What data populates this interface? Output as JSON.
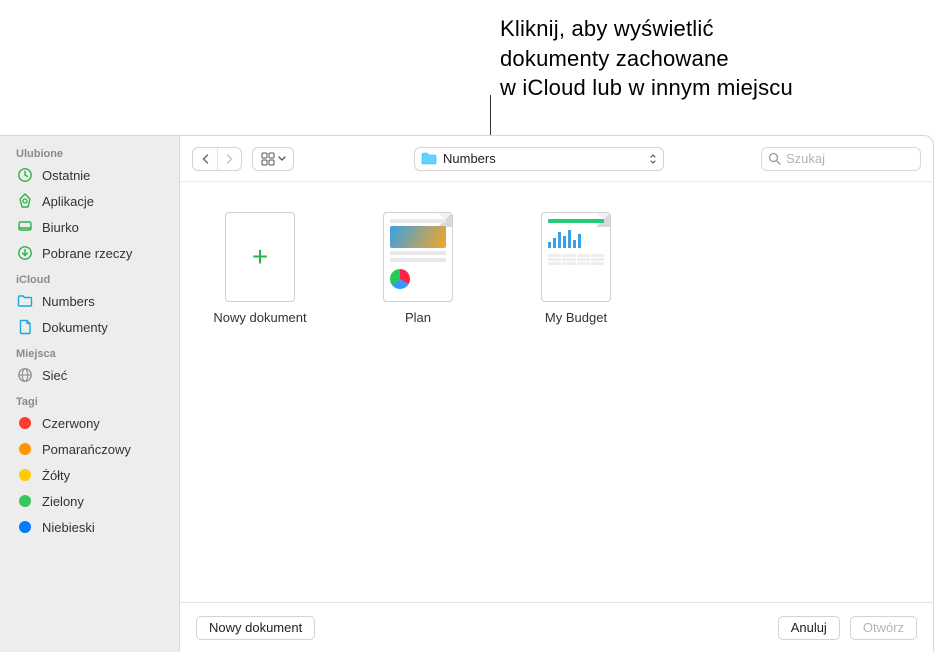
{
  "callout": {
    "line1": "Kliknij, aby wyświetlić",
    "line2": "dokumenty zachowane",
    "line3": "w iCloud lub w innym miejscu"
  },
  "sidebar": {
    "sections": [
      {
        "header": "Ulubione",
        "items": [
          {
            "icon": "clock",
            "label": "Ostatnie",
            "color": "#29b34a"
          },
          {
            "icon": "apps",
            "label": "Aplikacje",
            "color": "#29b34a"
          },
          {
            "icon": "desk",
            "label": "Biurko",
            "color": "#29b34a"
          },
          {
            "icon": "download",
            "label": "Pobrane rzeczy",
            "color": "#29b34a"
          }
        ]
      },
      {
        "header": "iCloud",
        "items": [
          {
            "icon": "folder",
            "label": "Numbers",
            "color": "#17a9e3"
          },
          {
            "icon": "document",
            "label": "Dokumenty",
            "color": "#17a9e3"
          }
        ]
      },
      {
        "header": "Miejsca",
        "items": [
          {
            "icon": "globe",
            "label": "Sieć",
            "color": "#8d8d92"
          }
        ]
      },
      {
        "header": "Tagi",
        "items": [
          {
            "icon": "dot",
            "label": "Czerwony",
            "color": "#ff3b30"
          },
          {
            "icon": "dot",
            "label": "Pomarańczowy",
            "color": "#ff9500"
          },
          {
            "icon": "dot",
            "label": "Żółty",
            "color": "#ffcc00"
          },
          {
            "icon": "dot",
            "label": "Zielony",
            "color": "#34c759"
          },
          {
            "icon": "dot",
            "label": "Niebieski",
            "color": "#007aff"
          }
        ]
      }
    ]
  },
  "toolbar": {
    "location_label": "Numbers",
    "search_placeholder": "Szukaj"
  },
  "content": {
    "items": [
      {
        "kind": "new",
        "label": "Nowy dokument"
      },
      {
        "kind": "plan",
        "label": "Plan"
      },
      {
        "kind": "budget",
        "label": "My Budget"
      }
    ]
  },
  "footer": {
    "new_doc": "Nowy dokument",
    "cancel": "Anuluj",
    "open": "Otwórz"
  }
}
